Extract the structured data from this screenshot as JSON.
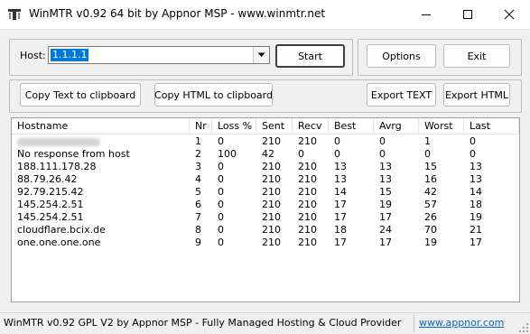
{
  "window": {
    "title": "WinMTR v0.92 64 bit by Appnor MSP - www.winmtr.net",
    "icons": {
      "app": "winmtr-app-icon",
      "minimize": "minimize-icon",
      "maximize": "maximize-icon",
      "close": "close-icon"
    }
  },
  "host": {
    "label": "Host:",
    "value": "1.1.1.1",
    "dropdown_icon": "chevron-down-icon",
    "start_label": "Start"
  },
  "buttons": {
    "options": "Options",
    "exit": "Exit",
    "copy_text": "Copy Text to clipboard",
    "copy_html": "Copy HTML to clipboard",
    "export_text": "Export TEXT",
    "export_html": "Export HTML"
  },
  "table": {
    "columns": [
      "Hostname",
      "Nr",
      "Loss %",
      "Sent",
      "Recv",
      "Best",
      "Avrg",
      "Worst",
      "Last"
    ],
    "rows": [
      {
        "hostname": "",
        "nr": "1",
        "loss": "0",
        "sent": "210",
        "recv": "210",
        "best": "0",
        "avrg": "0",
        "worst": "1",
        "last": "0"
      },
      {
        "hostname": "No response from host",
        "nr": "2",
        "loss": "100",
        "sent": "42",
        "recv": "0",
        "best": "0",
        "avrg": "0",
        "worst": "0",
        "last": "0"
      },
      {
        "hostname": "188.111.178.28",
        "nr": "3",
        "loss": "0",
        "sent": "210",
        "recv": "210",
        "best": "13",
        "avrg": "13",
        "worst": "15",
        "last": "13"
      },
      {
        "hostname": "88.79.26.42",
        "nr": "4",
        "loss": "0",
        "sent": "210",
        "recv": "210",
        "best": "13",
        "avrg": "13",
        "worst": "16",
        "last": "13"
      },
      {
        "hostname": "92.79.215.42",
        "nr": "5",
        "loss": "0",
        "sent": "210",
        "recv": "210",
        "best": "14",
        "avrg": "15",
        "worst": "42",
        "last": "14"
      },
      {
        "hostname": "145.254.2.51",
        "nr": "6",
        "loss": "0",
        "sent": "210",
        "recv": "210",
        "best": "17",
        "avrg": "19",
        "worst": "57",
        "last": "18"
      },
      {
        "hostname": "145.254.2.51",
        "nr": "7",
        "loss": "0",
        "sent": "210",
        "recv": "210",
        "best": "17",
        "avrg": "17",
        "worst": "26",
        "last": "19"
      },
      {
        "hostname": "cloudflare.bcix.de",
        "nr": "8",
        "loss": "0",
        "sent": "210",
        "recv": "210",
        "best": "18",
        "avrg": "24",
        "worst": "70",
        "last": "21"
      },
      {
        "hostname": "one.one.one.one",
        "nr": "9",
        "loss": "0",
        "sent": "210",
        "recv": "210",
        "best": "17",
        "avrg": "17",
        "worst": "19",
        "last": "17"
      }
    ]
  },
  "status": {
    "text": "WinMTR v0.92 GPL V2 by Appnor MSP - Fully Managed Hosting & Cloud Provider",
    "link": "www.appnor.com",
    "grip_icon": "resize-grip-icon"
  },
  "colors": {
    "selection": "#0078d7",
    "link": "#0066cc",
    "background": "#f0f0f0"
  }
}
